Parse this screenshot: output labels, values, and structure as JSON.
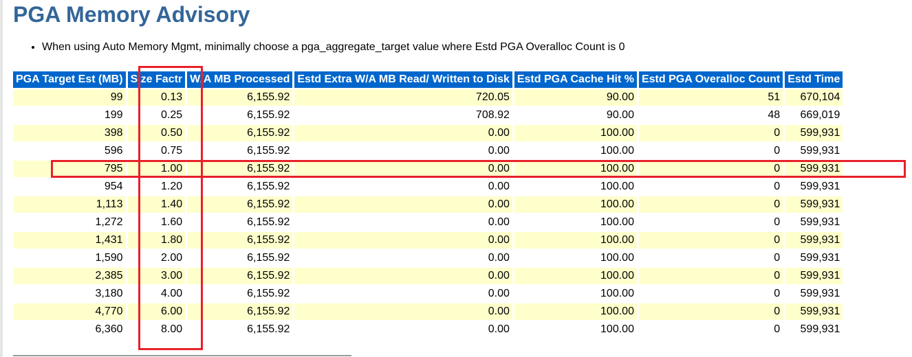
{
  "page_title": "PGA Memory Advisory",
  "notes": [
    "When using Auto Memory Mgmt, minimally choose a pga_aggregate_target value where Estd PGA Overalloc Count is 0"
  ],
  "table": {
    "headers": [
      "PGA Target Est (MB)",
      "Size Factr",
      "W/A MB Processed",
      "Estd Extra W/A MB Read/ Written to Disk",
      "Estd PGA Cache Hit %",
      "Estd PGA Overalloc Count",
      "Estd Time"
    ],
    "rows": [
      [
        "99",
        "0.13",
        "6,155.92",
        "720.05",
        "90.00",
        "51",
        "670,104"
      ],
      [
        "199",
        "0.25",
        "6,155.92",
        "708.92",
        "90.00",
        "48",
        "669,019"
      ],
      [
        "398",
        "0.50",
        "6,155.92",
        "0.00",
        "100.00",
        "0",
        "599,931"
      ],
      [
        "596",
        "0.75",
        "6,155.92",
        "0.00",
        "100.00",
        "0",
        "599,931"
      ],
      [
        "795",
        "1.00",
        "6,155.92",
        "0.00",
        "100.00",
        "0",
        "599,931"
      ],
      [
        "954",
        "1.20",
        "6,155.92",
        "0.00",
        "100.00",
        "0",
        "599,931"
      ],
      [
        "1,113",
        "1.40",
        "6,155.92",
        "0.00",
        "100.00",
        "0",
        "599,931"
      ],
      [
        "1,272",
        "1.60",
        "6,155.92",
        "0.00",
        "100.00",
        "0",
        "599,931"
      ],
      [
        "1,431",
        "1.80",
        "6,155.92",
        "0.00",
        "100.00",
        "0",
        "599,931"
      ],
      [
        "1,590",
        "2.00",
        "6,155.92",
        "0.00",
        "100.00",
        "0",
        "599,931"
      ],
      [
        "2,385",
        "3.00",
        "6,155.92",
        "0.00",
        "100.00",
        "0",
        "599,931"
      ],
      [
        "3,180",
        "4.00",
        "6,155.92",
        "0.00",
        "100.00",
        "0",
        "599,931"
      ],
      [
        "4,770",
        "6.00",
        "6,155.92",
        "0.00",
        "100.00",
        "0",
        "599,931"
      ],
      [
        "6,360",
        "8.00",
        "6,155.92",
        "0.00",
        "100.00",
        "0",
        "599,931"
      ]
    ]
  },
  "colors": {
    "title": "#336699",
    "header_bg": "#0066cc",
    "row_odd": "#ffffcc",
    "row_even": "#ffffff",
    "highlight": "#e8202a"
  }
}
